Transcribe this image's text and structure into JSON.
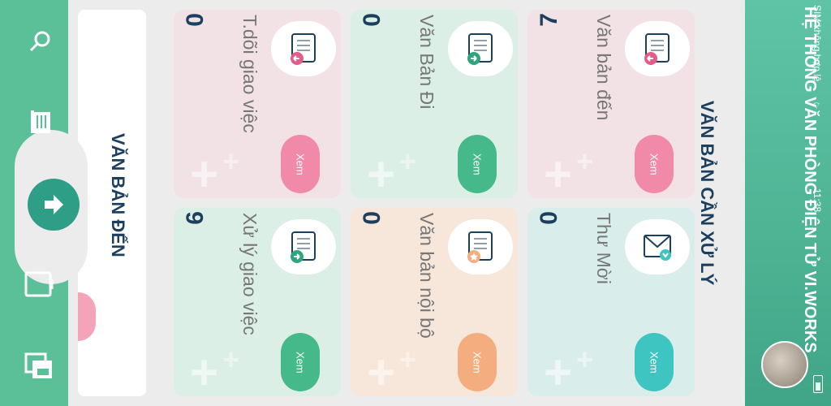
{
  "header": {
    "title": "HỆ THỐNG VĂN PHÒNG ĐIỆN TỬ VI.WORKS",
    "status_sim": "SIM không hợp lệ",
    "status_time": "11:38"
  },
  "section_title": "VĂN BẢN CẦN XỬ LÝ",
  "panel_title": "VĂN BẢN ĐẾN",
  "cards": [
    {
      "label": "Văn bản đến",
      "count": "7",
      "button": "Xem",
      "color": "#f2e2e6",
      "btn_color": "#f08aa8",
      "icon": "document-incoming-icon"
    },
    {
      "label": "Văn Bản Đi",
      "count": "0",
      "button": "Xem",
      "color": "#dcefe6",
      "btn_color": "#45b98a",
      "icon": "document-outgoing-icon"
    },
    {
      "label": "T.dõi giao việc",
      "count": "0",
      "button": "Xem",
      "color": "#f2e2e6",
      "btn_color": "#f08aa8",
      "icon": "document-track-icon"
    },
    {
      "label": "Thư Mời",
      "count": "0",
      "button": "Xem",
      "color": "#d9eeeb",
      "btn_color": "#3ec4c1",
      "icon": "envelope-icon"
    },
    {
      "label": "Văn bản nội bộ",
      "count": "0",
      "button": "Xem",
      "color": "#f7e6da",
      "btn_color": "#f4ad7e",
      "icon": "document-internal-icon"
    },
    {
      "label": "Xử lý giao việc",
      "count": "6",
      "button": "Xem",
      "color": "#dcefe6",
      "btn_color": "#45b98a",
      "icon": "document-task-icon"
    }
  ],
  "nav": [
    "search-icon",
    "document-list-icon",
    "incoming-arrow-icon",
    "tablet-icon",
    "windows-icon"
  ]
}
